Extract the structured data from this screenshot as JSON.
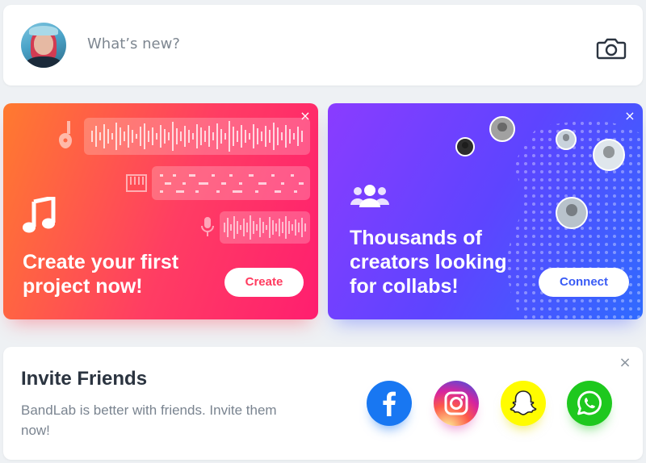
{
  "composer": {
    "placeholder": "What’s new?",
    "camera_icon": "camera-icon",
    "avatar_icon": "user-avatar"
  },
  "create_card": {
    "title": "Create your first\nproject now!",
    "button_label": "Create",
    "close_label": "×",
    "icons": [
      "music-note-icon",
      "guitar-icon",
      "keyboard-icon",
      "microphone-icon"
    ],
    "accent_color": "#ff3d63"
  },
  "connect_card": {
    "title": "Thousands of\ncreators looking\nfor collabs!",
    "button_label": "Connect",
    "close_label": "×",
    "icons": [
      "group-icon"
    ],
    "accent_color": "#3a5cf5"
  },
  "invite": {
    "title": "Invite Friends",
    "description": "BandLab is better with friends. Invite them now!",
    "close_label": "×",
    "socials": [
      {
        "name": "facebook",
        "icon": "facebook-icon",
        "color": "#1877f2"
      },
      {
        "name": "instagram",
        "icon": "instagram-icon",
        "color": "#d6249f"
      },
      {
        "name": "snapchat",
        "icon": "snapchat-icon",
        "color": "#fffc00"
      },
      {
        "name": "whatsapp",
        "icon": "whatsapp-icon",
        "color": "#1ec81e"
      }
    ]
  }
}
